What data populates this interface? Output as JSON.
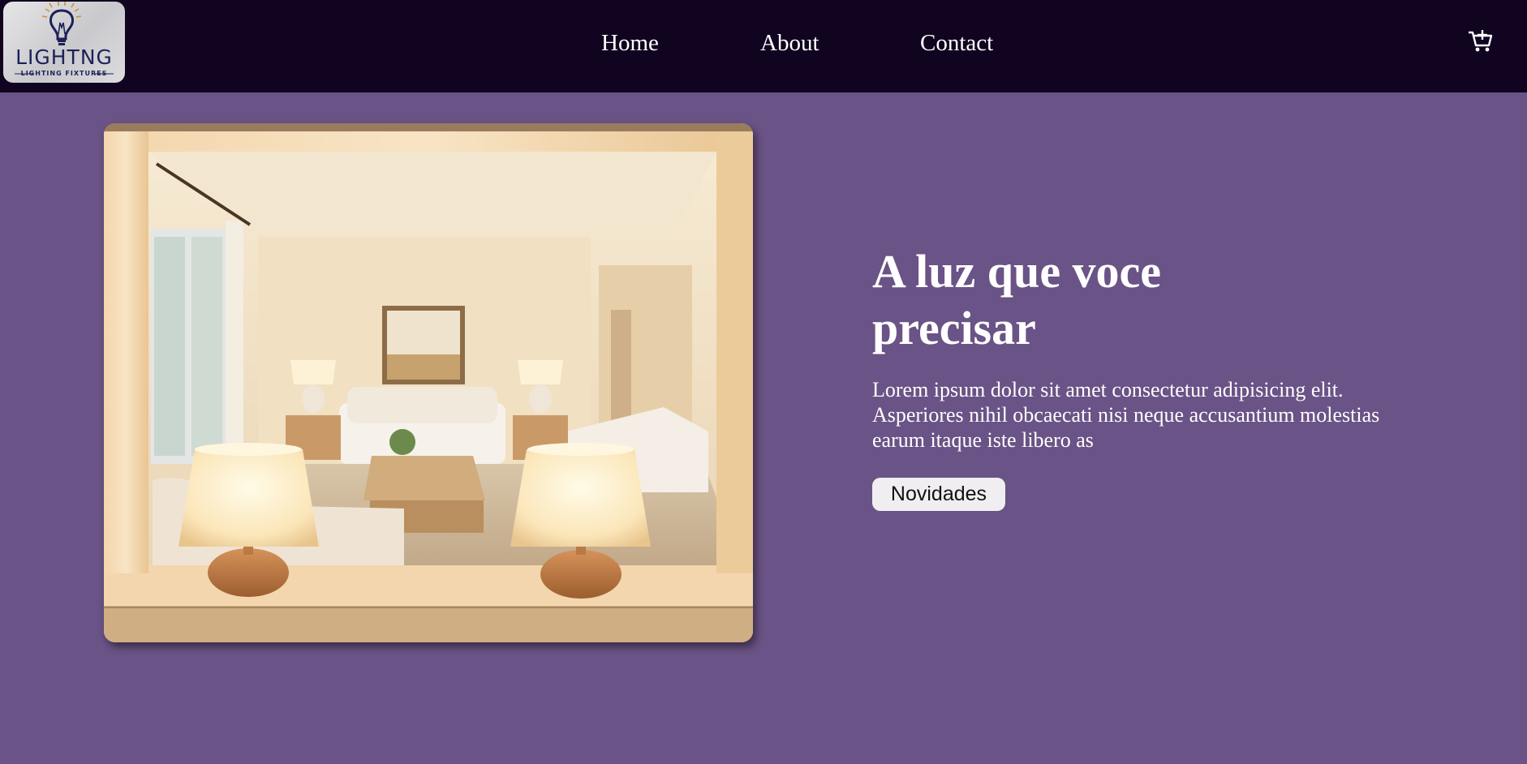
{
  "header": {
    "logo": {
      "word": "LIGHTNG",
      "tagline": "LIGHTING FIXTURES",
      "icon": "lightbulb-icon"
    },
    "nav": [
      {
        "label": "Home"
      },
      {
        "label": "About"
      },
      {
        "label": "Contact"
      }
    ],
    "cart_icon": "cart-icon"
  },
  "hero": {
    "image_alt": "living-room-lamps-photo",
    "title": "A luz que voce precisar",
    "text": "Lorem ipsum dolor sit amet consectetur adipisicing elit. Asperiores nihil obcaecati nisi neque accusantium molestias earum itaque iste libero as",
    "button_label": "Novidades"
  },
  "colors": {
    "nav_bg": "#100420",
    "page_bg": "#6a5386",
    "text": "#ffffff",
    "button_bg": "#f0eef1"
  }
}
